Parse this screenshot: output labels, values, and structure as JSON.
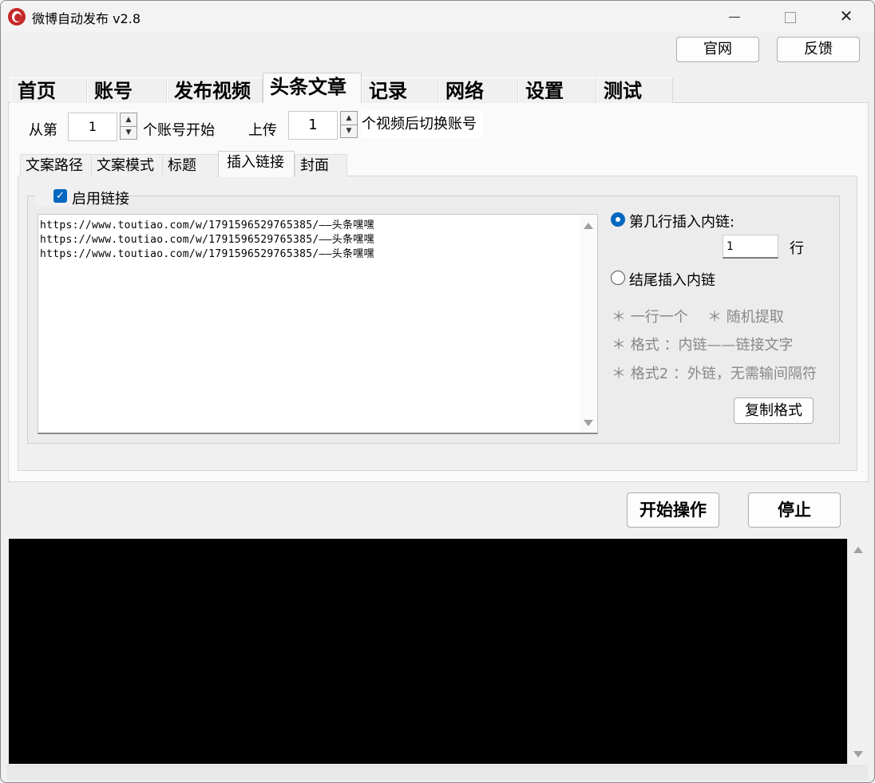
{
  "window": {
    "title": "微博自动发布  v2.8",
    "minimize": "–",
    "maximize": "☐",
    "close": "✕"
  },
  "top_buttons": {
    "website": "官网",
    "feedback": "反馈"
  },
  "main_tabs": [
    "首页",
    "账号",
    "发布视频",
    "头条文章",
    "记录",
    "网络",
    "设置",
    "测试"
  ],
  "active_main_tab": "头条文章",
  "start_row": {
    "prefix": "从第",
    "value": "1",
    "suffix": "个账号开始",
    "upload_prefix": "上传",
    "upload_value": "1",
    "upload_suffix": "个视频后切换账号"
  },
  "sub_tabs": [
    "文案路径",
    "文案模式",
    "标题",
    "插入链接",
    "封面"
  ],
  "active_sub_tab": "插入链接",
  "link_group": {
    "enable_label": "启用链接",
    "enabled": true,
    "lines": [
      "https://www.toutiao.com/w/1791596529765385/——头条嘿嘿",
      "https://www.toutiao.com/w/1791596529765385/——头条嘿嘿",
      "https://www.toutiao.com/w/1791596529765385/——头条嘿嘿"
    ]
  },
  "insert_options": {
    "line_option": "第几行插入内链:",
    "line_value": "1",
    "line_unit": "行",
    "end_option": "结尾插入内链",
    "selected": "line"
  },
  "hints": {
    "one_per_line": "＊ 一行一个",
    "random": "＊ 随机提取",
    "format1": "＊ 格式 ：内链——链接文字",
    "format2": "＊ 格式2 ：外链，无需输间隔符"
  },
  "buttons": {
    "copy_format": "复制格式",
    "start": "开始操作",
    "stop": "停止"
  },
  "colors": {
    "accent": "#0067c0",
    "console_bg": "#000000"
  }
}
